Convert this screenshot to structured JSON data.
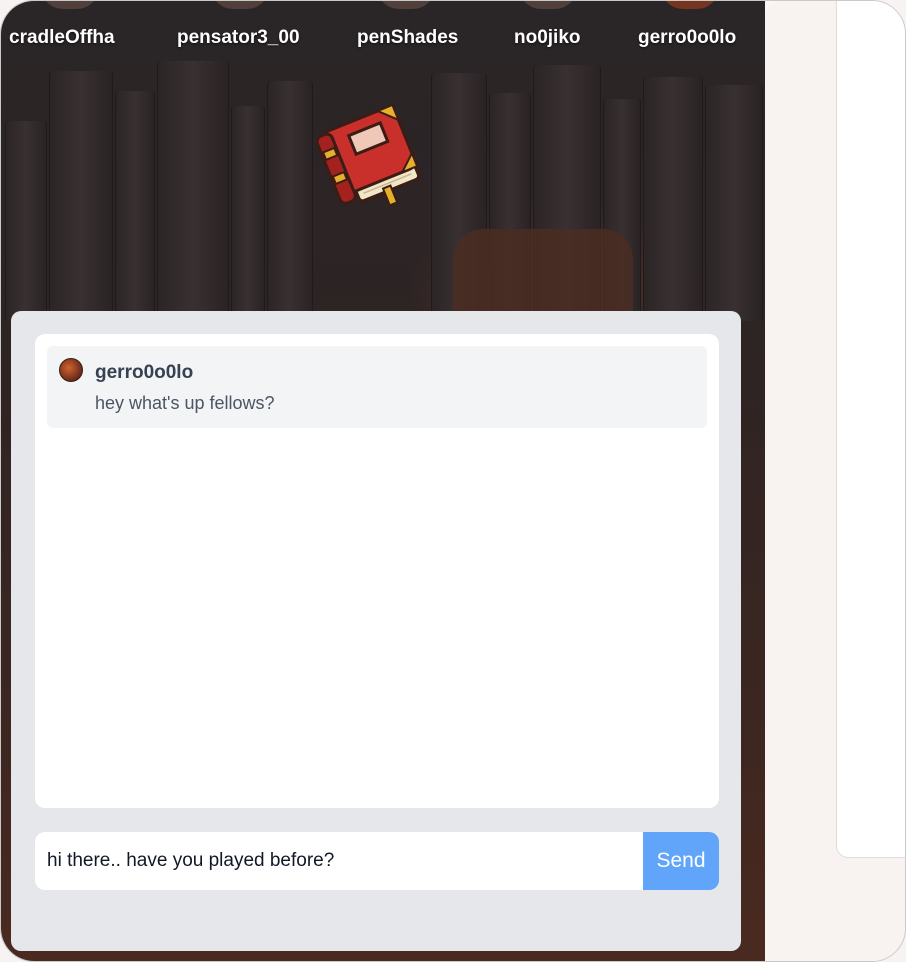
{
  "players": [
    {
      "name": "cradleOffha"
    },
    {
      "name": "pensator3_00"
    },
    {
      "name": "penShades"
    },
    {
      "name": "no0jiko"
    },
    {
      "name": "gerro0o0lo"
    }
  ],
  "chat": {
    "messages": [
      {
        "user": "gerro0o0lo",
        "text": "hey what's up fellows?"
      }
    ],
    "input_value": "hi there.. have you played before?",
    "send_label": "Send"
  },
  "icons": {
    "center_item": "red-book-icon",
    "message_avatar": "avatar-icon"
  },
  "colors": {
    "send_button": "#60a5fa",
    "chat_panel": "#e5e7eb",
    "message_bg": "#f3f4f6",
    "book_red": "#c9302c"
  }
}
